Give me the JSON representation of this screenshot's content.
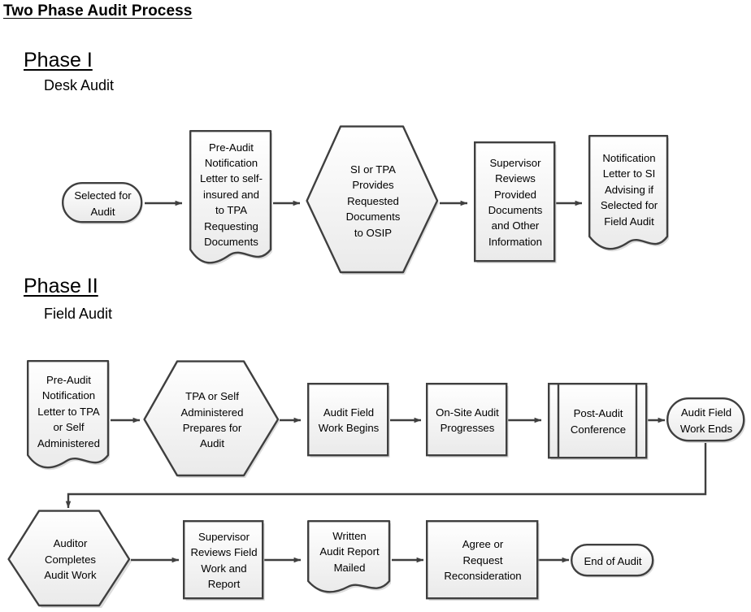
{
  "document": {
    "title": "Two Phase Audit Process"
  },
  "phases": [
    {
      "id": "phase-1",
      "title": "Phase I",
      "subtitle": "Desk Audit"
    },
    {
      "id": "phase-2",
      "title": "Phase II",
      "subtitle": "Field Audit"
    }
  ],
  "colors": {
    "stroke": "#3f3f3f",
    "fill_top": "#ffffff",
    "fill_bottom": "#ececec",
    "text": "#000000",
    "connector": "#3f3f3f",
    "shadow": "#bfbfbf"
  },
  "nodes": {
    "selected_for_audit": {
      "label": "Selected for\nAudit",
      "shape": "terminator"
    },
    "pre_audit_letter_si_tpa": {
      "label": "Pre-Audit\nNotification\nLetter to self-\ninsured and\nto TPA\nRequesting\nDocuments",
      "shape": "document"
    },
    "si_tpa_provides_docs": {
      "label": "SI or TPA\nProvides\nRequested\nDocuments\nto OSIP",
      "shape": "hexagon"
    },
    "supervisor_reviews_docs": {
      "label": "Supervisor\nReviews\nProvided\nDocuments\nand Other\nInformation",
      "shape": "process"
    },
    "notification_letter_si": {
      "label": "Notification\nLetter to SI\nAdvising if\nSelected for\nField Audit",
      "shape": "document"
    },
    "pre_audit_letter_tpa": {
      "label": "Pre-Audit\nNotification\nLetter to TPA\nor Self\nAdministered",
      "shape": "document"
    },
    "tpa_prepares_for_audit": {
      "label": "TPA or Self\nAdministered\nPrepares for\nAudit",
      "shape": "hexagon"
    },
    "audit_field_work_begins": {
      "label": "Audit Field\nWork Begins",
      "shape": "process"
    },
    "on_site_audit_progresses": {
      "label": "On-Site Audit\nProgresses",
      "shape": "process"
    },
    "post_audit_conference": {
      "label": "Post-Audit\nConference",
      "shape": "predefined-process"
    },
    "audit_field_work_ends": {
      "label": "Audit Field\nWork Ends",
      "shape": "terminator"
    },
    "auditor_completes_work": {
      "label": "Auditor\nCompletes\nAudit Work",
      "shape": "hexagon"
    },
    "supervisor_reviews_field": {
      "label": "Supervisor\nReviews Field\nWork and\nReport",
      "shape": "process"
    },
    "written_report_mailed": {
      "label": "Written\nAudit Report\nMailed",
      "shape": "document"
    },
    "agree_or_reconsider": {
      "label": "Agree or\nRequest\nReconsideration",
      "shape": "process"
    },
    "end_of_audit": {
      "label": "End of Audit",
      "shape": "terminator"
    }
  },
  "flow": {
    "phase_1_sequence": [
      "selected_for_audit",
      "pre_audit_letter_si_tpa",
      "si_tpa_provides_docs",
      "supervisor_reviews_docs",
      "notification_letter_si"
    ],
    "phase_2_sequence": [
      "pre_audit_letter_tpa",
      "tpa_prepares_for_audit",
      "audit_field_work_begins",
      "on_site_audit_progresses",
      "post_audit_conference",
      "audit_field_work_ends",
      "auditor_completes_work",
      "supervisor_reviews_field",
      "written_report_mailed",
      "agree_or_reconsider",
      "end_of_audit"
    ]
  }
}
